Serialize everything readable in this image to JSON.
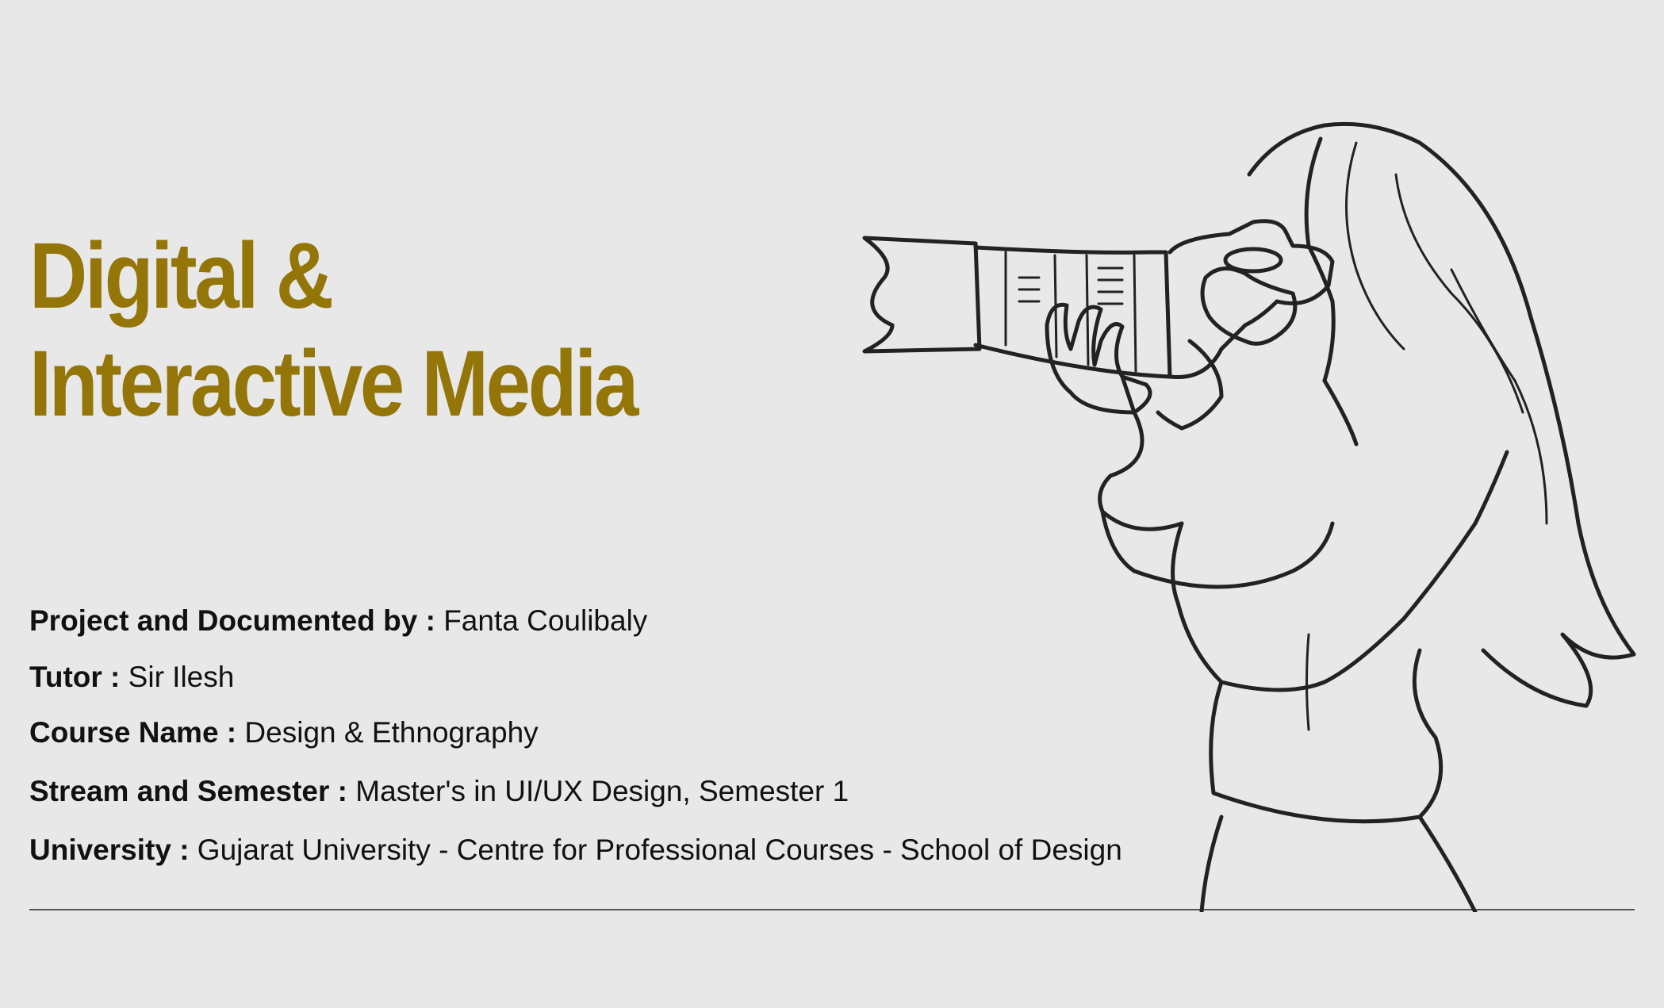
{
  "title": {
    "line1": "Digital &",
    "line2": "Interactive Media"
  },
  "info": [
    {
      "key": "Project and Documented by : ",
      "value": "Fanta Coulibaly"
    },
    {
      "key": "Tutor : ",
      "value": "Sir Ilesh"
    },
    {
      "key": "Course Name : ",
      "value": "Design & Ethnography"
    },
    {
      "key": "Stream and Semester : ",
      "value": "Master's in UI/UX Design, Semester 1"
    },
    {
      "key": "University : ",
      "value": "Gujarat University - Centre for Professional Courses - School of Design"
    }
  ],
  "colors": {
    "background": "#e8e8e8",
    "title": "#937508",
    "text": "#111111",
    "rule": "#555555"
  },
  "illustration": {
    "icon": "photographer-line-art"
  }
}
